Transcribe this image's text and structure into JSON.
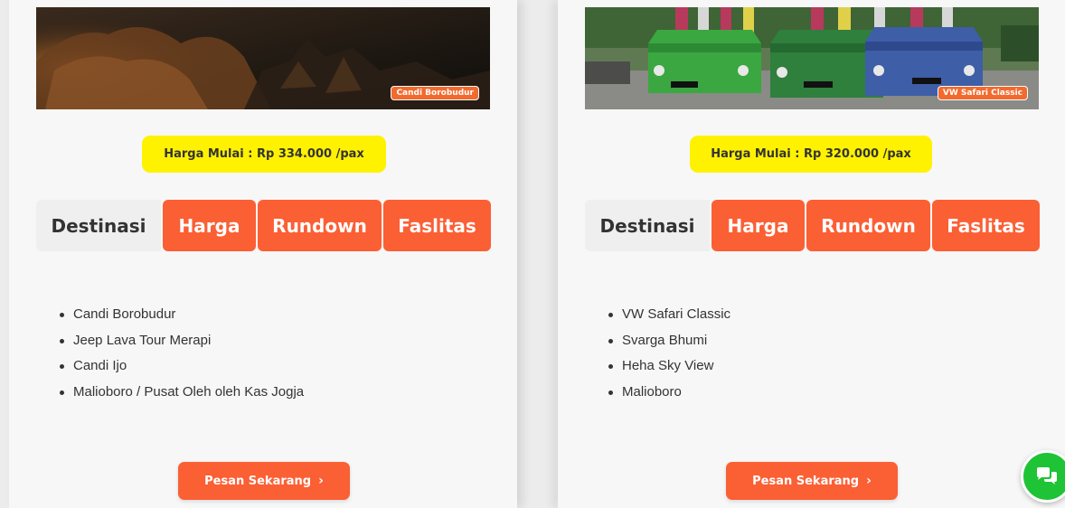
{
  "cards": [
    {
      "hero_tag": "Candi Borobudur",
      "price": "Harga Mulai : Rp 334.000 /pax",
      "tabs": [
        "Destinasi",
        "Harga",
        "Rundown",
        "Faslitas"
      ],
      "destinations": [
        "Candi Borobudur",
        "Jeep Lava Tour Merapi",
        "Candi Ijo",
        "Malioboro / Pusat Oleh oleh Kas Jogja"
      ],
      "cta": "Pesan Sekarang",
      "cta_chevron": "›"
    },
    {
      "hero_tag": "VW Safari Classic",
      "price": "Harga Mulai : Rp 320.000 /pax",
      "tabs": [
        "Destinasi",
        "Harga",
        "Rundown",
        "Faslitas"
      ],
      "destinations": [
        "VW Safari Classic",
        "Svarga Bhumi",
        "Heha Sky View",
        "Malioboro"
      ],
      "cta": "Pesan Sekarang",
      "cta_chevron": "›"
    }
  ],
  "colors": {
    "accent": "#fb5f34",
    "price_bg": "#fff200",
    "chat": "#1ec436"
  },
  "icons": {
    "chat": "chat-bubbles-icon",
    "chevron": "chevron-right-icon"
  }
}
